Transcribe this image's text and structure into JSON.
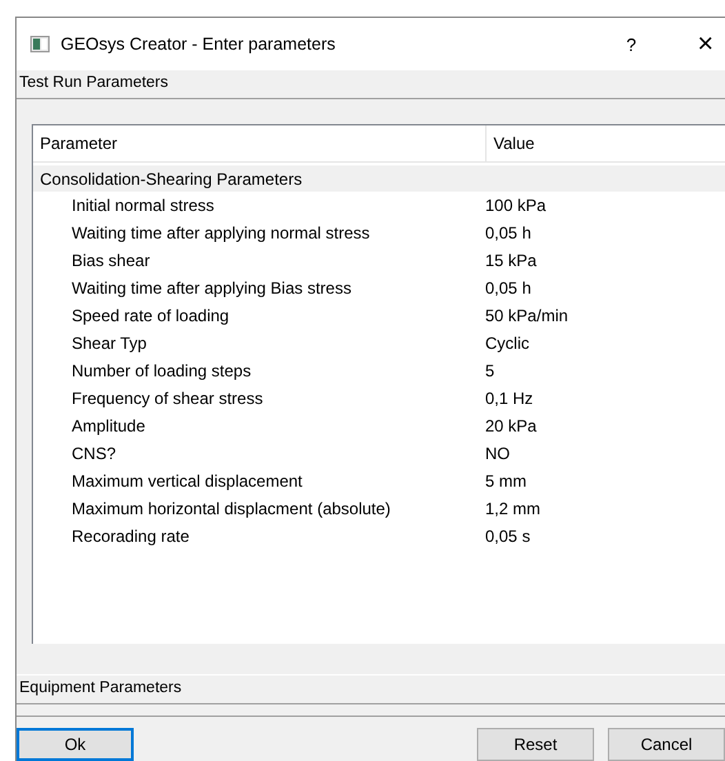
{
  "window": {
    "title": "GEOsys Creator - Enter parameters",
    "help": "?",
    "close": "×"
  },
  "sections": [
    {
      "title": "Test Run Parameters"
    },
    {
      "title": "Equipment Parameters"
    }
  ],
  "table": {
    "columns": [
      "Parameter",
      "Value"
    ],
    "group": "Consolidation-Shearing Parameters",
    "rows": [
      {
        "name": "Initial normal stress",
        "value": "100 kPa"
      },
      {
        "name": "Waiting time after applying normal stress",
        "value": "0,05 h"
      },
      {
        "name": "Bias shear",
        "value": "15 kPa"
      },
      {
        "name": "Waiting time after applying Bias stress",
        "value": "0,05 h"
      },
      {
        "name": "Speed rate of loading",
        "value": "50 kPa/min"
      },
      {
        "name": "Shear Typ",
        "value": "Cyclic"
      },
      {
        "name": "Number of loading steps",
        "value": "5"
      },
      {
        "name": "Frequency of shear stress",
        "value": "0,1 Hz"
      },
      {
        "name": "Amplitude",
        "value": "20 kPa"
      },
      {
        "name": "CNS?",
        "value": "NO"
      },
      {
        "name": "Maximum vertical displacement",
        "value": "5 mm"
      },
      {
        "name": "Maximum horizontal displacment (absolute)",
        "value": "1,2 mm"
      },
      {
        "name": "Recorading rate",
        "value": "0,05 s"
      }
    ]
  },
  "buttons": [
    {
      "label": "Ok",
      "default": true
    },
    {
      "label": "Reset",
      "default": false
    },
    {
      "label": "Cancel",
      "default": false
    }
  ]
}
